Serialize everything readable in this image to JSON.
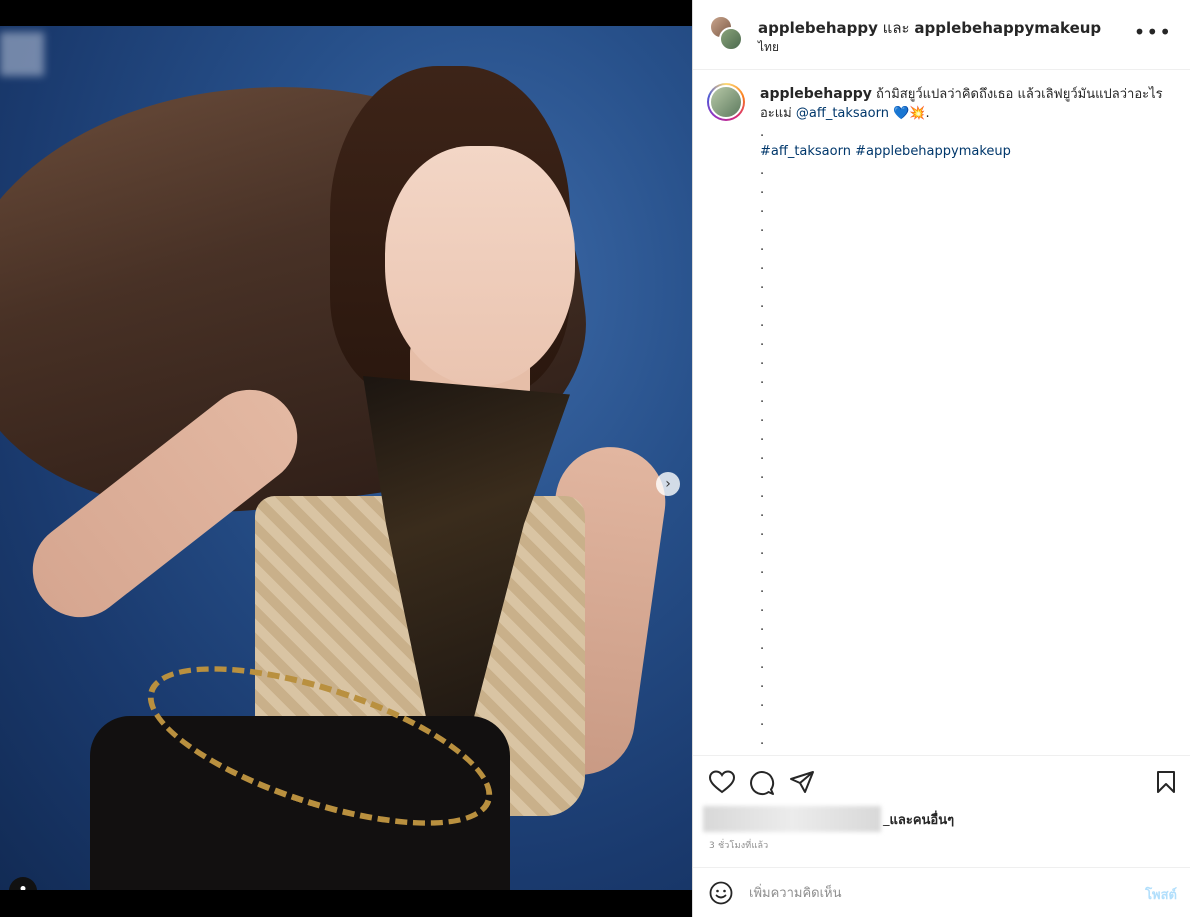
{
  "header": {
    "user1": "applebehappy",
    "connector": "และ",
    "user2": "applebehappymakeup",
    "location": "ไทย"
  },
  "caption": {
    "username": "applebehappy",
    "text": "ถ้ามิสยูว์แปลว่าคิดถึงเธอ แล้วเลิฟยูว์มันแปลว่าอะไรอะแม่",
    "mention": "@aff_taksaorn",
    "emojis": "💙💥.",
    "first_dot": ".",
    "hashtags": "#aff_taksaorn #applebehappymakeup",
    "dot_lines": [
      ".",
      ".",
      ".",
      ".",
      ".",
      ".",
      ".",
      ".",
      ".",
      ".",
      ".",
      ".",
      ".",
      ".",
      ".",
      ".",
      ".",
      ".",
      ".",
      ".",
      ".",
      ".",
      ".",
      ".",
      ".",
      ".",
      ".",
      ".",
      ".",
      ".",
      ".",
      "."
    ]
  },
  "actions": {
    "likes_suffix": "และคนอื่นๆ",
    "likes_prefix": "_",
    "time_ago": "3 ชั่วโมงที่แล้ว"
  },
  "comment": {
    "placeholder": "เพิ่มความคิดเห็น",
    "post_label": "โพสต์"
  },
  "media": {
    "carousel_dots": 4,
    "active_dot": 1
  }
}
